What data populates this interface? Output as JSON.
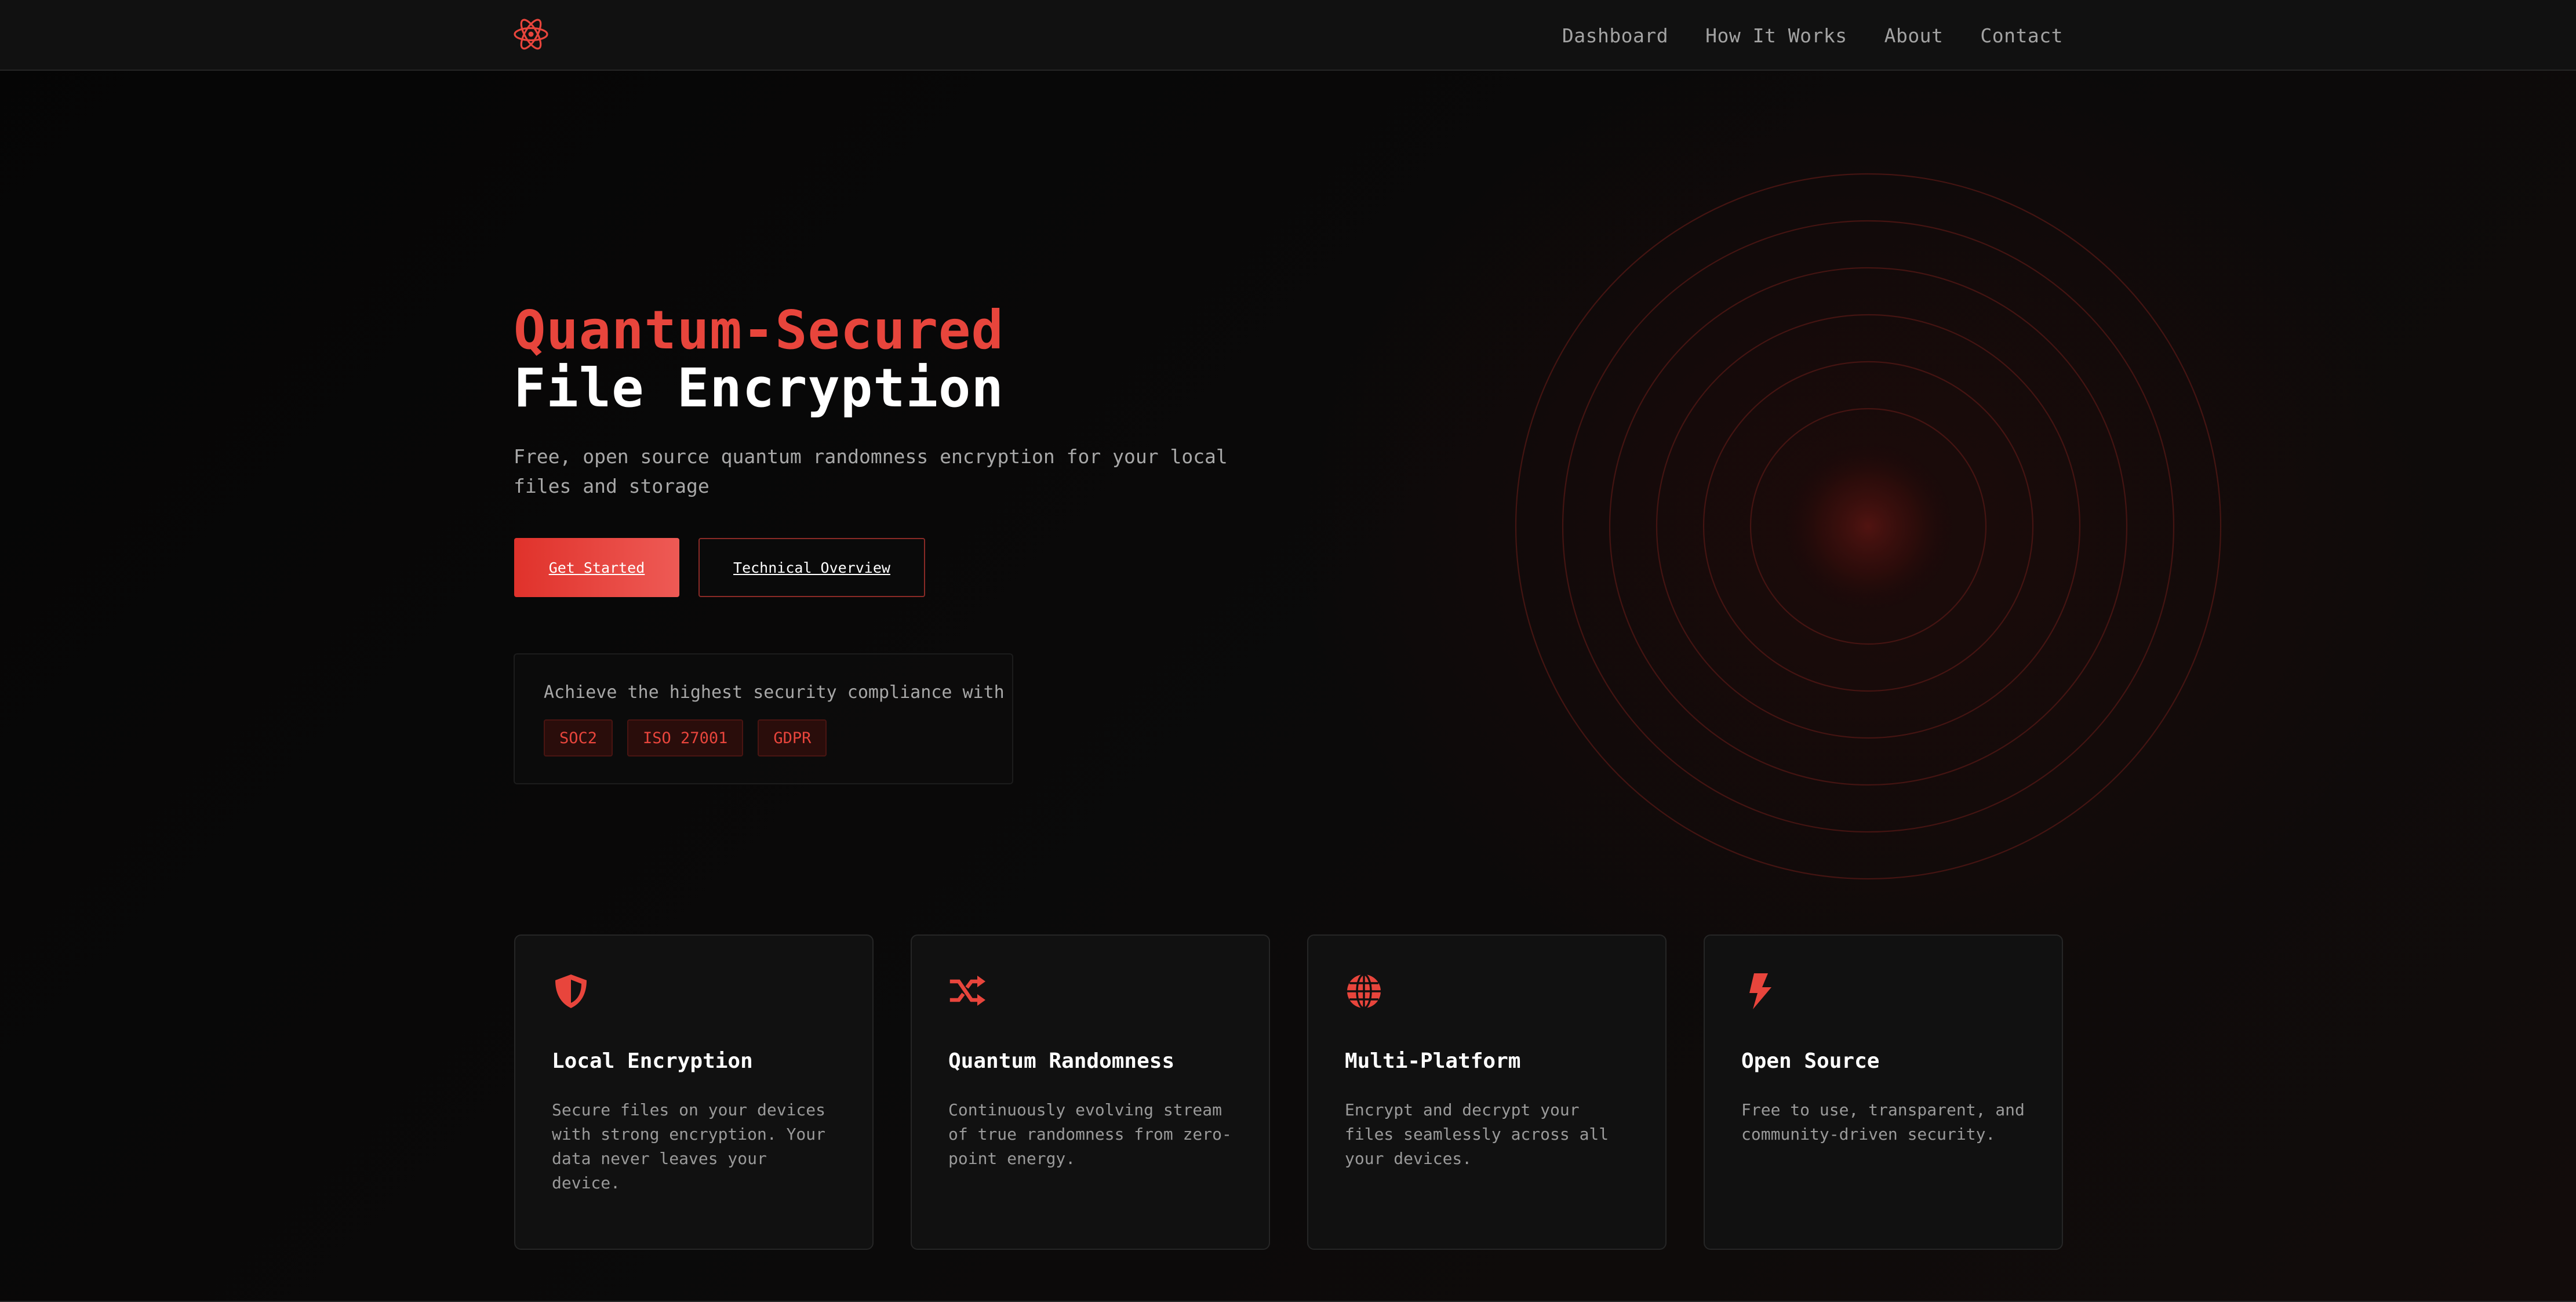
{
  "nav": {
    "logo_icon": "atom-icon",
    "items": [
      "Dashboard",
      "How It Works",
      "About",
      "Contact"
    ]
  },
  "hero": {
    "title_accent": "Quantum-Secured",
    "title_main": "File Encryption",
    "subtitle": "Free, open source quantum randomness encryption for your local files and storage",
    "primary_button": "Get Started",
    "secondary_button": "Technical Overview"
  },
  "compliance": {
    "text": "Achieve the highest security compliance with",
    "badges": [
      "SOC2",
      "ISO 27001",
      "GDPR"
    ]
  },
  "features": [
    {
      "icon": "shield-icon",
      "title": "Local Encryption",
      "description": "Secure files on your devices with strong encryption. Your data never leaves your device."
    },
    {
      "icon": "shuffle-icon",
      "title": "Quantum Randomness",
      "description": "Continuously evolving stream of true randomness from zero-point energy."
    },
    {
      "icon": "globe-icon",
      "title": "Multi-Platform",
      "description": "Encrypt and decrypt your files seamlessly across all your devices."
    },
    {
      "icon": "bolt-icon",
      "title": "Open Source",
      "description": "Free to use, transparent, and community-driven security."
    }
  ],
  "colors": {
    "accent": "#e8453c",
    "background": "#0a0a0a",
    "card": "#111111",
    "badge_bg": "#2a0d0b"
  }
}
